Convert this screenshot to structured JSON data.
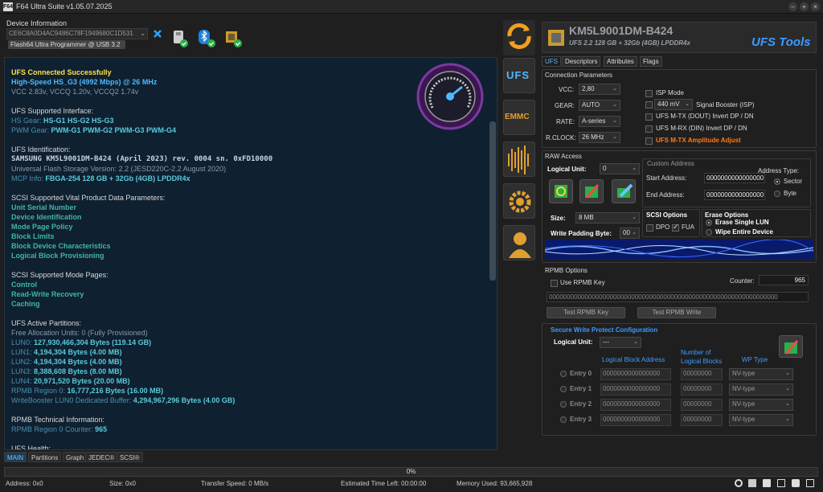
{
  "window": {
    "title": "F64 Ultra Suite v1.05.07.2025",
    "logo": "F64"
  },
  "device": {
    "section_title": "Device Information",
    "serial_select": "CE6C8A0D4AC9486C78F1949680C1D531",
    "programmer": "Flash64 Ultra Programmer @ USB 3.2"
  },
  "log": [
    {
      "text": "UFS Connected Successfully",
      "cls": "c-yel"
    },
    {
      "parts": [
        {
          "t": "High-Speed HS_G3  (4992 Mbps) @ 26 MHz",
          "c": "c-blu"
        }
      ]
    },
    {
      "text": "VCC 2.83v, VCCQ 1.20v, VCCQ2 1.74v",
      "cls": "c-gry"
    },
    {
      "text": "",
      "cls": ""
    },
    {
      "text": "UFS Supported Interface:",
      "cls": "c-wht"
    },
    {
      "parts": [
        {
          "t": "HS Gear: ",
          "c": "c-dim"
        },
        {
          "t": "HS-G1 HS-G2 HS-G3",
          "c": "c-cyn"
        }
      ]
    },
    {
      "parts": [
        {
          "t": "PWM Gear: ",
          "c": "c-dim"
        },
        {
          "t": "PWM-G1 PWM-G2 PWM-G3 PWM-G4",
          "c": "c-cyn"
        }
      ]
    },
    {
      "text": "",
      "cls": ""
    },
    {
      "text": "UFS Identification:",
      "cls": "c-wht"
    },
    {
      "text": "SAMSUNG KM5L9001DM-B424 (April 2023) rev. 0004 sn. 0xFD10000",
      "cls": "c-mon"
    },
    {
      "text": "Universal Flash Storage Version: 2.2 (JESD220C-2.2 August 2020)",
      "cls": "c-gry"
    },
    {
      "parts": [
        {
          "t": "MCP Info: ",
          "c": "c-dim"
        },
        {
          "t": "FBGA-254  128 GB + 32Gb (4GB) LPDDR4x",
          "c": "c-cyn"
        }
      ]
    },
    {
      "text": "",
      "cls": ""
    },
    {
      "text": "SCSI Supported Vital Product Data Parameters:",
      "cls": "c-wht"
    },
    {
      "text": "Unit Serial Number",
      "cls": "c-tel"
    },
    {
      "text": "Device Identification",
      "cls": "c-tel"
    },
    {
      "text": "Mode Page Policy",
      "cls": "c-tel"
    },
    {
      "text": "Block Limits",
      "cls": "c-tel"
    },
    {
      "text": "Block Device Characteristics",
      "cls": "c-tel"
    },
    {
      "text": "Logical Block Provisioning",
      "cls": "c-tel"
    },
    {
      "text": "",
      "cls": ""
    },
    {
      "text": "SCSI Supported Mode Pages:",
      "cls": "c-wht"
    },
    {
      "text": "Control",
      "cls": "c-tel"
    },
    {
      "text": "Read-Write Recovery",
      "cls": "c-tel"
    },
    {
      "text": "Caching",
      "cls": "c-tel"
    },
    {
      "text": "",
      "cls": ""
    },
    {
      "text": "UFS Active Partitions:",
      "cls": "c-wht"
    },
    {
      "text": "Free Allocation Units: 0 (Fully Provisioned)",
      "cls": "c-gry"
    },
    {
      "parts": [
        {
          "t": "LUN0: ",
          "c": "c-dim"
        },
        {
          "t": "127,930,466,304 Bytes (119.14 GB)",
          "c": "c-cyn"
        }
      ]
    },
    {
      "parts": [
        {
          "t": "LUN1: ",
          "c": "c-dim"
        },
        {
          "t": "4,194,304 Bytes (4.00 MB)",
          "c": "c-cyn"
        }
      ]
    },
    {
      "parts": [
        {
          "t": "LUN2: ",
          "c": "c-dim"
        },
        {
          "t": "4,194,304 Bytes (4.00 MB)",
          "c": "c-cyn"
        }
      ]
    },
    {
      "parts": [
        {
          "t": "LUN3: ",
          "c": "c-dim"
        },
        {
          "t": "8,388,608 Bytes (8.00 MB)",
          "c": "c-cyn"
        }
      ]
    },
    {
      "parts": [
        {
          "t": "LUN4: ",
          "c": "c-dim"
        },
        {
          "t": "20,971,520 Bytes (20.00 MB)",
          "c": "c-cyn"
        }
      ]
    },
    {
      "parts": [
        {
          "t": "RPMB Region 0: ",
          "c": "c-dim"
        },
        {
          "t": "16,777,216 Bytes (16.00 MB)",
          "c": "c-cyn"
        }
      ]
    },
    {
      "parts": [
        {
          "t": "WriteBooster LUN0 Dedicated Buffer: ",
          "c": "c-dim"
        },
        {
          "t": "4,294,967,296 Bytes (4.00 GB)",
          "c": "c-cyn"
        }
      ]
    },
    {
      "text": "",
      "cls": ""
    },
    {
      "text": "RPMB Technical Information:",
      "cls": "c-wht"
    },
    {
      "parts": [
        {
          "t": "RPMB Region 0 Counter: ",
          "c": "c-dim"
        },
        {
          "t": "965",
          "c": "c-cyn"
        }
      ]
    },
    {
      "text": "",
      "cls": ""
    },
    {
      "text": "UFS Health:",
      "cls": "c-wht"
    }
  ],
  "bottom_tabs": [
    "MAIN",
    "Partitions",
    "Graph",
    "JEDEC®",
    "SCSI®"
  ],
  "progress": {
    "text": "0%",
    "value": 0
  },
  "status": {
    "address": "Address: 0x0",
    "size": "Size: 0x0",
    "speed": "Transfer Speed: 0 MB/s",
    "eta": "Estimated Time Left: 00:00:00",
    "memory": "Memory Used: 93,665,928"
  },
  "chip": {
    "model": "KM5L9001DM-B424",
    "info": "UFS 2.2   128 GB + 32Gb (4GB) LPDDR4x",
    "brand": "UFS Tools"
  },
  "side_icons": [
    "UFS",
    "EMMC"
  ],
  "right_tabs": [
    "UFS",
    "Descriptors",
    "Attributes",
    "Flags"
  ],
  "conn": {
    "title": "Connection Parameters",
    "vcc_label": "VCC:",
    "vcc": "2,80",
    "gear_label": "GEAR:",
    "gear": "AUTO",
    "rate_label": "RATE:",
    "rate": "A-series",
    "rclock_label": "R.CLOCK:",
    "rclock": "26 MHz",
    "isp_mode": "ISP Mode",
    "booster_value": "440 mV",
    "booster_label": "Signal Booster (ISP)",
    "mtx_invert": "UFS M-TX (DOUT) Invert DP / DN",
    "mrx_invert": "UFS M-RX (DIN) Invert DP / DN",
    "mtx_amp": "UFS M-TX Amplitude Adjust"
  },
  "raw": {
    "title": "RAW Access",
    "lu_label": "Logical Unit:",
    "lu": "0",
    "custom_title": "Custom Address",
    "addr_type_label": "Address Type:",
    "sector": "Sector",
    "byte": "Byte",
    "start_label": "Start Address:",
    "start": "0000000000000000",
    "end_label": "End Address:",
    "end": "0000000000000000",
    "size_label": "Size:",
    "size": "8 MB",
    "pad_label": "Write Padding Byte:",
    "pad": "00",
    "scsi_title": "SCSI Options",
    "dpo": "DPO",
    "fua": "FUA",
    "erase_title": "Erase Options",
    "erase_single": "Erase Single LUN",
    "erase_all": "Wipe Entire Device"
  },
  "rpmb": {
    "title": "RPMB Options",
    "use_key": "Use RPMB Key",
    "counter_label": "Counter:",
    "counter": "965",
    "key": "0000000000000000000000000000000000000000000000000000000000000000",
    "test_key": "Test RPMB Key",
    "test_write": "Test RPMB Write"
  },
  "swp": {
    "title": "Secure Write Protect Configuration",
    "lu_label": "Logical Unit:",
    "lu": "---",
    "col_lba": "Logical Block Address",
    "col_num": "Number of Logical Blocks",
    "col_type": "WP Type",
    "entries": [
      {
        "label": "Entry 0",
        "lba": "0000000000000000",
        "num": "00000000",
        "type": "NV-type"
      },
      {
        "label": "Entry 1",
        "lba": "0000000000000000",
        "num": "00000000",
        "type": "NV-type"
      },
      {
        "label": "Entry 2",
        "lba": "0000000000000000",
        "num": "00000000",
        "type": "NV-type"
      },
      {
        "label": "Entry 3",
        "lba": "0000000000000000",
        "num": "00000000",
        "type": "NV-type"
      }
    ]
  }
}
